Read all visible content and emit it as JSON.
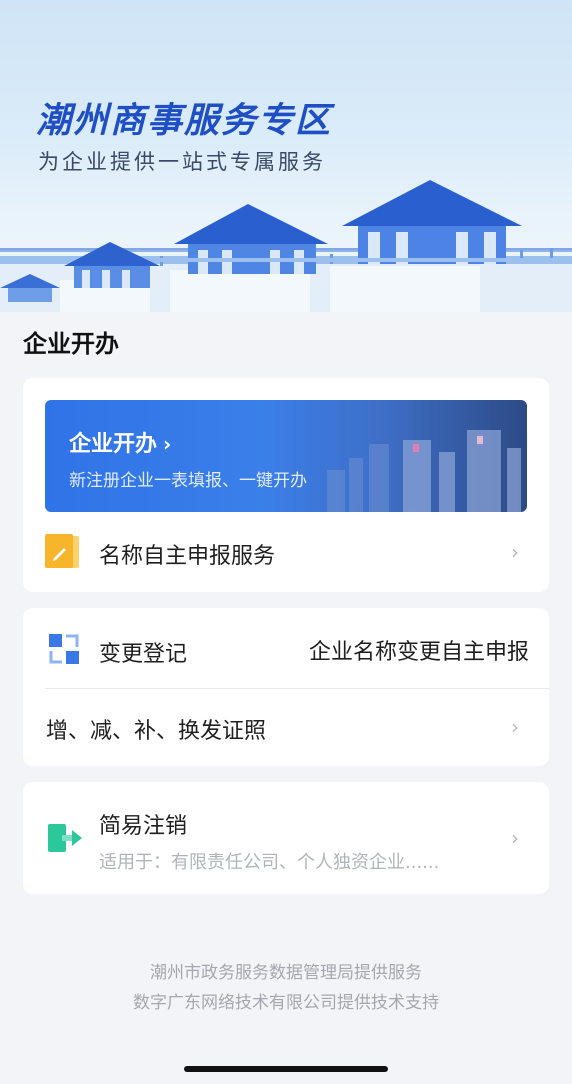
{
  "banner": {
    "title": "潮州商事服务专区",
    "subtitle": "为企业提供一站式专属服务"
  },
  "section": {
    "title": "企业开办"
  },
  "promo": {
    "title": "企业开办",
    "chevron": "›",
    "subtitle": "新注册企业一表填报、一键开办"
  },
  "name_service": {
    "label": "名称自主申报服务",
    "icon": "pencil-note-icon",
    "arrow": "›"
  },
  "change": {
    "label": "变更登记",
    "right_label": "企业名称变更自主申报",
    "icon": "change-register-icon",
    "sub_label": "增、减、补、换发证照",
    "arrow": "›"
  },
  "cancel": {
    "label": "简易注销",
    "desc": "适用于：有限责任公司、个人独资企业......",
    "icon": "exit-icon",
    "arrow": "›"
  },
  "footer": {
    "line1": "潮州市政务服务数据管理局提供服务",
    "line2": "数字广东网络技术有限公司提供技术支持"
  },
  "colors": {
    "accent": "#2f73e8",
    "brand_title": "#1f4fc4",
    "icon_yellow": "#f7b52c",
    "icon_green": "#2cc79a",
    "icon_blue": "#3a78e6"
  }
}
